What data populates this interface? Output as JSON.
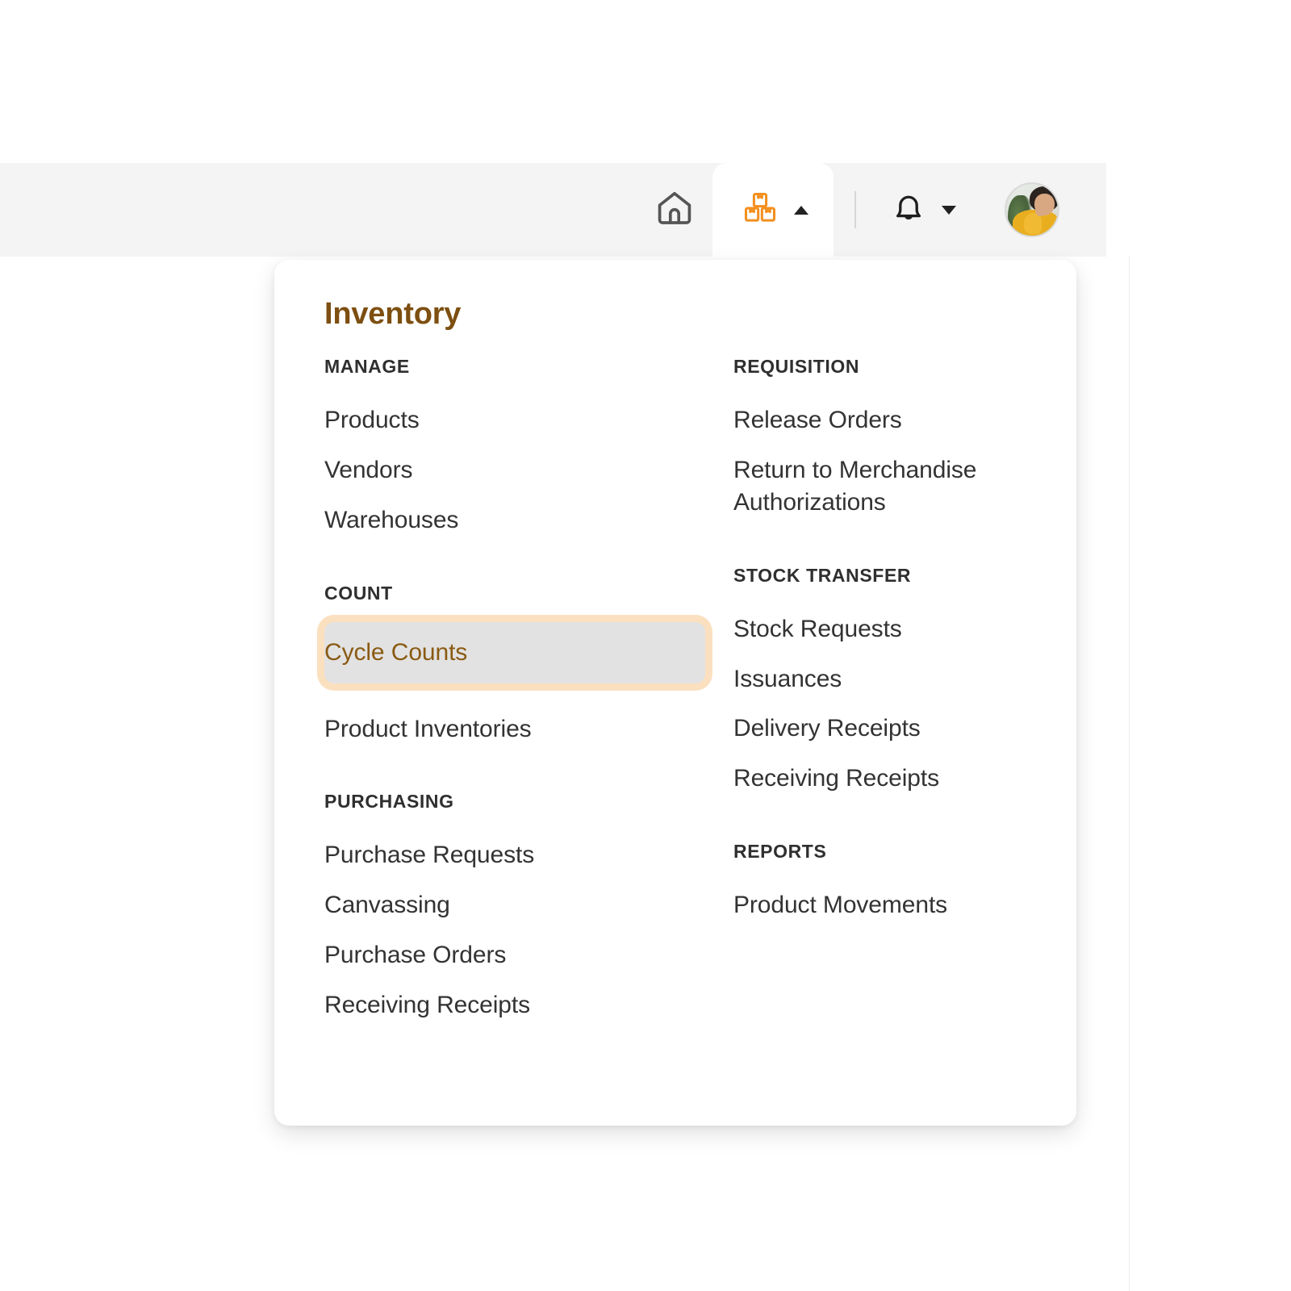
{
  "topbar": {
    "home_icon": "home-icon",
    "inventory_icon": "boxes-icon",
    "inventory_caret": "caret-up-icon",
    "notifications_icon": "bell-icon",
    "notifications_caret": "caret-down-icon",
    "avatar": "user-avatar"
  },
  "menu": {
    "title": "Inventory",
    "accent_color": "#7d4f11",
    "selected_bg": "#e2e2e2",
    "selected_ring": "#fbe0c0",
    "brand_orange": "#f2901f",
    "left_column": [
      {
        "heading": "MANAGE",
        "items": [
          {
            "label": "Products",
            "selected": false
          },
          {
            "label": "Vendors",
            "selected": false
          },
          {
            "label": "Warehouses",
            "selected": false
          }
        ]
      },
      {
        "heading": "COUNT",
        "items": [
          {
            "label": "Cycle Counts",
            "selected": true
          },
          {
            "label": "Product Inventories",
            "selected": false
          }
        ]
      },
      {
        "heading": "PURCHASING",
        "items": [
          {
            "label": "Purchase Requests",
            "selected": false
          },
          {
            "label": "Canvassing",
            "selected": false
          },
          {
            "label": "Purchase Orders",
            "selected": false
          },
          {
            "label": "Receiving Receipts",
            "selected": false
          }
        ]
      }
    ],
    "right_column": [
      {
        "heading": "REQUISITION",
        "items": [
          {
            "label": "Release Orders",
            "selected": false
          },
          {
            "label": "Return to Merchandise Authorizations",
            "selected": false
          }
        ]
      },
      {
        "heading": "STOCK TRANSFER",
        "items": [
          {
            "label": "Stock Requests",
            "selected": false
          },
          {
            "label": "Issuances",
            "selected": false
          },
          {
            "label": "Delivery Receipts",
            "selected": false
          },
          {
            "label": "Receiving Receipts",
            "selected": false
          }
        ]
      },
      {
        "heading": "REPORTS",
        "items": [
          {
            "label": "Product Movements",
            "selected": false
          }
        ]
      }
    ]
  }
}
